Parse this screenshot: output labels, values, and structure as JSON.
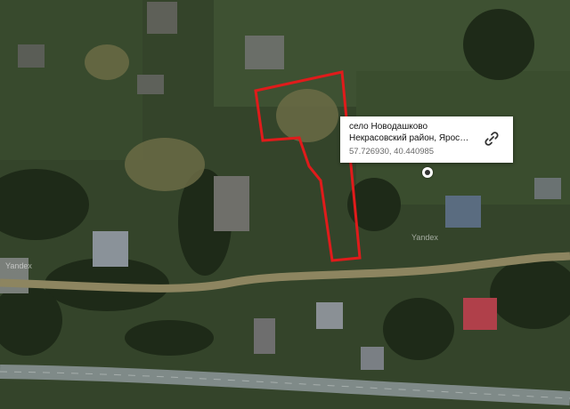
{
  "map": {
    "type": "satellite",
    "watermark_text": "Yandex",
    "plot_outline_color": "#e01b1b"
  },
  "popup": {
    "title": "село Новодашково",
    "subtitle": "Некрасовский район, Ярослав...",
    "coordinates": "57.726930, 40.440985",
    "share_icon": "link-icon"
  },
  "marker": {
    "icon": "location-pin-icon"
  }
}
